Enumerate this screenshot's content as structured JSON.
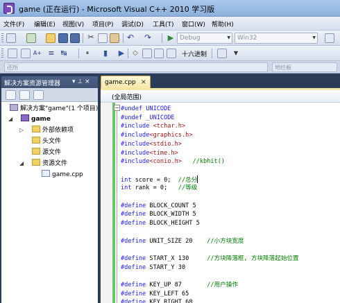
{
  "window": {
    "title": "game (正在运行) - Microsoft Visual C++ 2010 学习版"
  },
  "menu": [
    "文件(F)",
    "编辑(E)",
    "视图(V)",
    "项目(P)",
    "调试(D)",
    "工具(T)",
    "窗口(W)",
    "帮助(H)"
  ],
  "toolbar": {
    "config": "Debug",
    "platform": "Win32",
    "hex_label": "十六进制"
  },
  "scope": {
    "left": "还所",
    "right": "地栏板"
  },
  "solution_explorer": {
    "title": "解决方案资源管理器",
    "pin": "▾ ⊥ ×",
    "tree": [
      "解决方案\"game\"(1 个项目)",
      "game",
      "外部依赖项",
      "头文件",
      "源文件",
      "资源文件",
      "game.cpp"
    ]
  },
  "editor": {
    "tab": "game.cpp",
    "tab_close": "×",
    "scope": "(全局范围)",
    "lines": [
      {
        "t": [
          [
            "kw",
            "#undef UNICODE"
          ]
        ]
      },
      {
        "t": [
          [
            "kw",
            "#undef _UNICODE"
          ]
        ]
      },
      {
        "t": [
          [
            "kw",
            "#include "
          ],
          [
            "str",
            "<tchar.h>"
          ]
        ]
      },
      {
        "t": [
          [
            "kw",
            "#include"
          ],
          [
            "str",
            "<graphics.h>"
          ]
        ]
      },
      {
        "t": [
          [
            "kw",
            "#include"
          ],
          [
            "str",
            "<stdio.h>"
          ]
        ]
      },
      {
        "t": [
          [
            "kw",
            "#include"
          ],
          [
            "str",
            "<time.h>"
          ]
        ]
      },
      {
        "t": [
          [
            "kw",
            "#include"
          ],
          [
            "str",
            "<conio.h>"
          ],
          [
            "",
            "   "
          ],
          [
            "cm",
            "//kbhit()"
          ]
        ]
      },
      {
        "t": []
      },
      {
        "t": [
          [
            "kw",
            "int"
          ],
          [
            "",
            " score = 0;  "
          ],
          [
            "cm",
            "//总分"
          ]
        ],
        "caret": true
      },
      {
        "t": [
          [
            "kw",
            "int"
          ],
          [
            "",
            " rank = 0;   "
          ],
          [
            "cm",
            "//等级"
          ]
        ]
      },
      {
        "t": []
      },
      {
        "t": [
          [
            "kw",
            "#define"
          ],
          [
            "",
            " BLOCK_COUNT 5"
          ]
        ]
      },
      {
        "t": [
          [
            "kw",
            "#define"
          ],
          [
            "",
            " BLOCK_WIDTH 5"
          ]
        ]
      },
      {
        "t": [
          [
            "kw",
            "#define"
          ],
          [
            "",
            " BLOCK_HEIGHT 5"
          ]
        ]
      },
      {
        "t": []
      },
      {
        "t": [
          [
            "kw",
            "#define"
          ],
          [
            "",
            " UNIT_SIZE 20    "
          ],
          [
            "cm",
            "//小方块宽度"
          ]
        ]
      },
      {
        "t": []
      },
      {
        "t": [
          [
            "kw",
            "#define"
          ],
          [
            "",
            " START_X 130     "
          ],
          [
            "cm",
            "//方块降落框, 方块降落起始位置"
          ]
        ]
      },
      {
        "t": [
          [
            "kw",
            "#define"
          ],
          [
            "",
            " START_Y 30"
          ]
        ]
      },
      {
        "t": []
      },
      {
        "t": [
          [
            "kw",
            "#define"
          ],
          [
            "",
            " KEY_UP 87       "
          ],
          [
            "cm",
            "//用户操作"
          ]
        ]
      },
      {
        "t": [
          [
            "kw",
            "#define"
          ],
          [
            "",
            " KEY_LEFT 65"
          ]
        ]
      },
      {
        "t": [
          [
            "kw",
            "#define"
          ],
          [
            "",
            " KEY_RIGHT 68"
          ]
        ]
      }
    ]
  },
  "colors": {
    "keyword": "#1a1aff",
    "string": "#a31515",
    "comment": "#008000",
    "tab": "#f6e6a5"
  }
}
